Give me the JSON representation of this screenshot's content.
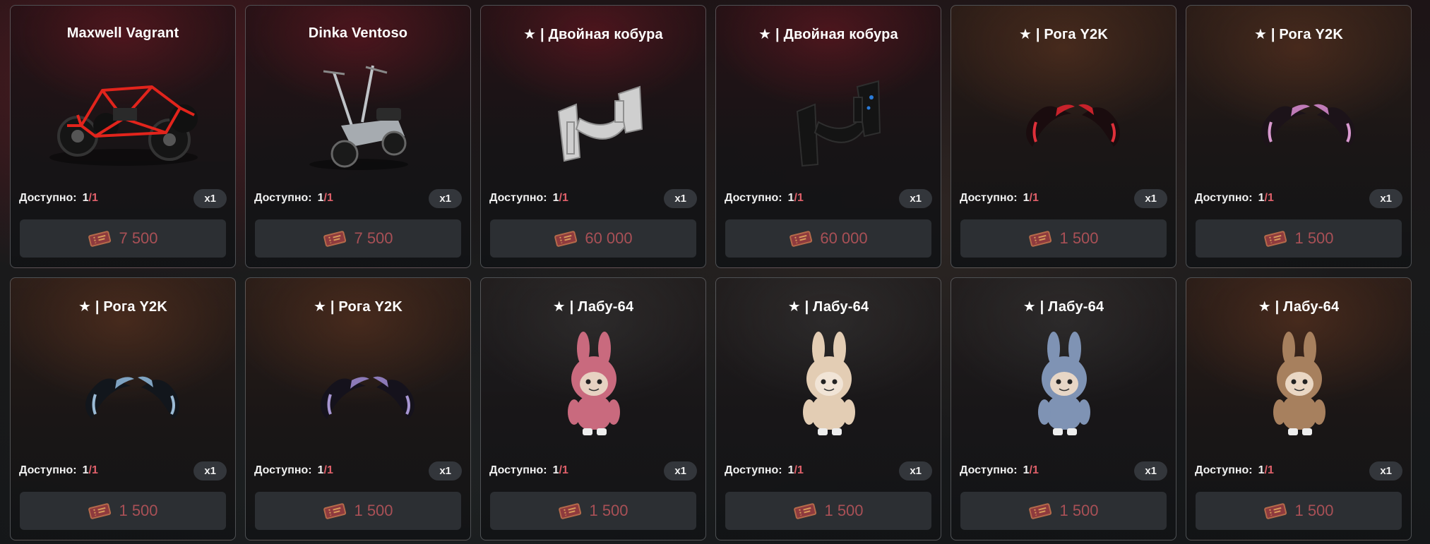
{
  "labels": {
    "available": "Доступно:"
  },
  "colors": {
    "accent_red": "#e0606a",
    "price_text": "#a95056"
  },
  "items": [
    {
      "title": "Maxwell Vagrant",
      "available": "1",
      "total": "/1",
      "qty": "x1",
      "price": "7 500",
      "icon": "buggy-icon"
    },
    {
      "title": "Dinka Ventoso",
      "available": "1",
      "total": "/1",
      "qty": "x1",
      "price": "7 500",
      "icon": "motorbike-icon"
    },
    {
      "title": "★ | Двойная кобура",
      "available": "1",
      "total": "/1",
      "qty": "x1",
      "price": "60 000",
      "icon": "holster-white-icon"
    },
    {
      "title": "★ | Двойная кобура",
      "available": "1",
      "total": "/1",
      "qty": "x1",
      "price": "60 000",
      "icon": "holster-black-icon"
    },
    {
      "title": "★ | Рога Y2K",
      "available": "1",
      "total": "/1",
      "qty": "x1",
      "price": "1 500",
      "icon": "horns-red-icon"
    },
    {
      "title": "★ | Рога Y2K",
      "available": "1",
      "total": "/1",
      "qty": "x1",
      "price": "1 500",
      "icon": "horns-pink-icon"
    },
    {
      "title": "★ | Рога Y2K",
      "available": "1",
      "total": "/1",
      "qty": "x1",
      "price": "1 500",
      "icon": "horns-blue-icon"
    },
    {
      "title": "★ | Рога Y2K",
      "available": "1",
      "total": "/1",
      "qty": "x1",
      "price": "1 500",
      "icon": "horns-purple-icon"
    },
    {
      "title": "★ | Лабу-64",
      "available": "1",
      "total": "/1",
      "qty": "x1",
      "price": "1 500",
      "icon": "plush-pink-icon"
    },
    {
      "title": "★ | Лабу-64",
      "available": "1",
      "total": "/1",
      "qty": "x1",
      "price": "1 500",
      "icon": "plush-cream-icon"
    },
    {
      "title": "★ | Лабу-64",
      "available": "1",
      "total": "/1",
      "qty": "x1",
      "price": "1 500",
      "icon": "plush-blue-icon"
    },
    {
      "title": "★ | Лабу-64",
      "available": "1",
      "total": "/1",
      "qty": "x1",
      "price": "1 500",
      "icon": "plush-brown-icon"
    }
  ]
}
